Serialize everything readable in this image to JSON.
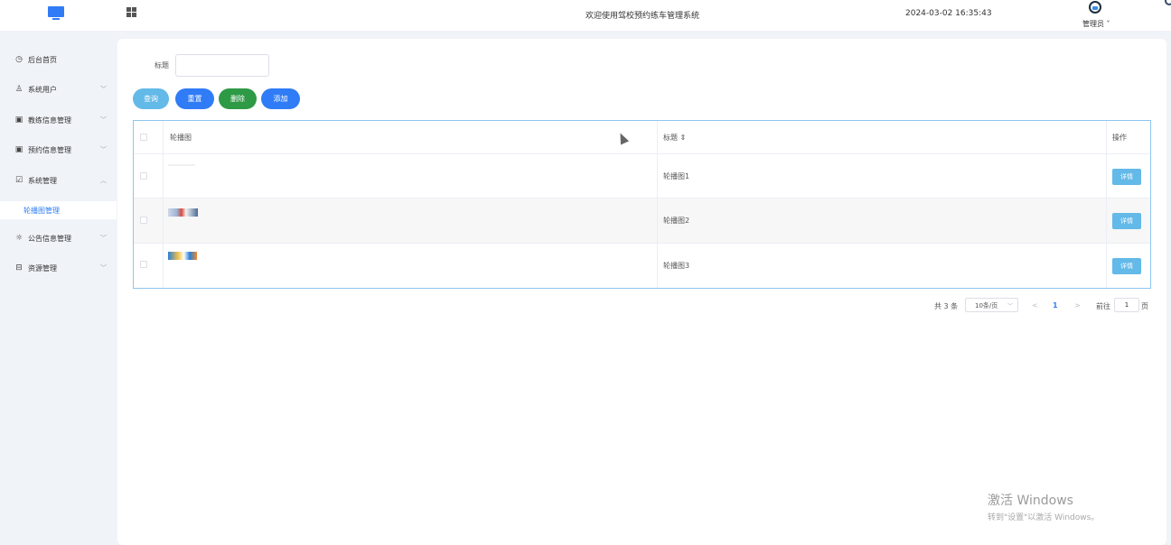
{
  "header": {
    "system_title": "欢迎使用驾校预约练车管理系统",
    "datetime": "2024-03-02 16:35:43",
    "user_label": "管理员 ˅"
  },
  "sidebar": {
    "items": [
      {
        "label": "后台首页",
        "icon": "clock-icon"
      },
      {
        "label": "系统用户",
        "icon": "user-icon"
      },
      {
        "label": "教练信息管理",
        "icon": "card-icon"
      },
      {
        "label": "预约信息管理",
        "icon": "card-icon"
      },
      {
        "label": "系统管理",
        "icon": "check-box-icon"
      },
      {
        "label": "公告信息管理",
        "icon": "broadcast-icon"
      },
      {
        "label": "资源管理",
        "icon": "folder-icon"
      }
    ],
    "active_sub_item": "轮播图管理"
  },
  "search": {
    "title_label": "标题",
    "title_value": ""
  },
  "toolbar": {
    "query": "查询",
    "reset": "重置",
    "delete": "删除",
    "add": "添加"
  },
  "table": {
    "columns": [
      "轮播图",
      "标题 ⇕",
      "操作"
    ],
    "rows": [
      {
        "title": "轮播图1",
        "action": "详情"
      },
      {
        "title": "轮播图2",
        "action": "详情"
      },
      {
        "title": "轮播图3",
        "action": "详情"
      }
    ]
  },
  "pagination": {
    "total": "共 3 条",
    "page_size": "10条/页",
    "prev": "<",
    "current_page": "1",
    "next": ">",
    "goto_label": "前往",
    "goto_value": "1",
    "page_suffix": "页"
  },
  "watermark": {
    "title": "激活 Windows",
    "subtitle": "转到\"设置\"以激活 Windows。"
  },
  "colors": {
    "accent": "#2f7cf6",
    "query_button": "#63b9e8",
    "delete_button": "#2e9a45",
    "table_border": "#8ec5f0"
  }
}
